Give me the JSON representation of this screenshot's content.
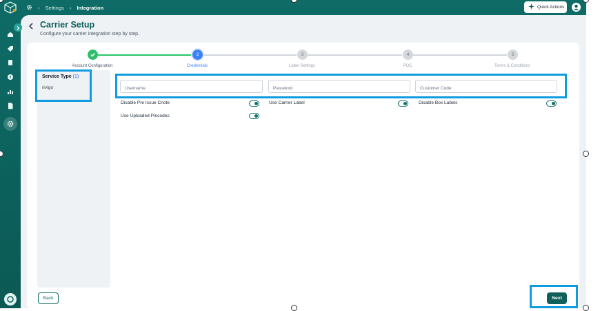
{
  "breadcrumbs": {
    "root_icon": "gear-icon",
    "first": "Settings",
    "current": "Integration"
  },
  "topbar": {
    "quick_actions_label": "Quick Actions",
    "quick_actions_icon": "sparkle-icon",
    "avatar_icon": "user-icon"
  },
  "header": {
    "title": "Carrier Setup",
    "subtitle": "Configure your carrier integration step by step."
  },
  "stepper": {
    "steps": [
      {
        "number": "",
        "label": "Account Configuration",
        "status": "done"
      },
      {
        "number": "2",
        "label": "Credentials",
        "status": "current"
      },
      {
        "number": "3",
        "label": "Label Settings",
        "status": "pending"
      },
      {
        "number": "4",
        "label": "POC",
        "status": "pending"
      },
      {
        "number": "5",
        "label": "Terms & Conditions",
        "status": "pending"
      }
    ]
  },
  "service_type": {
    "heading": "Service Type",
    "count": "(1)",
    "items": [
      "rivigo"
    ]
  },
  "credentials": {
    "username_placeholder": "Username",
    "password_placeholder": "Password",
    "customer_code_placeholder": "Customer Code"
  },
  "toggles": [
    {
      "label": "Disable Pre Issue Cnote",
      "on": true
    },
    {
      "label": "Use Carrier Label",
      "on": true
    },
    {
      "label": "Disable Box Labels",
      "on": true
    },
    {
      "label": "Use Uploaded Pincodes",
      "on": true
    }
  ],
  "footer": {
    "back_label": "Back",
    "next_label": "Next"
  },
  "colors": {
    "brand": "#0f5f5b",
    "step_done": "#2fbf6a",
    "step_current": "#3b82f6",
    "highlight": "#0e9be0"
  }
}
